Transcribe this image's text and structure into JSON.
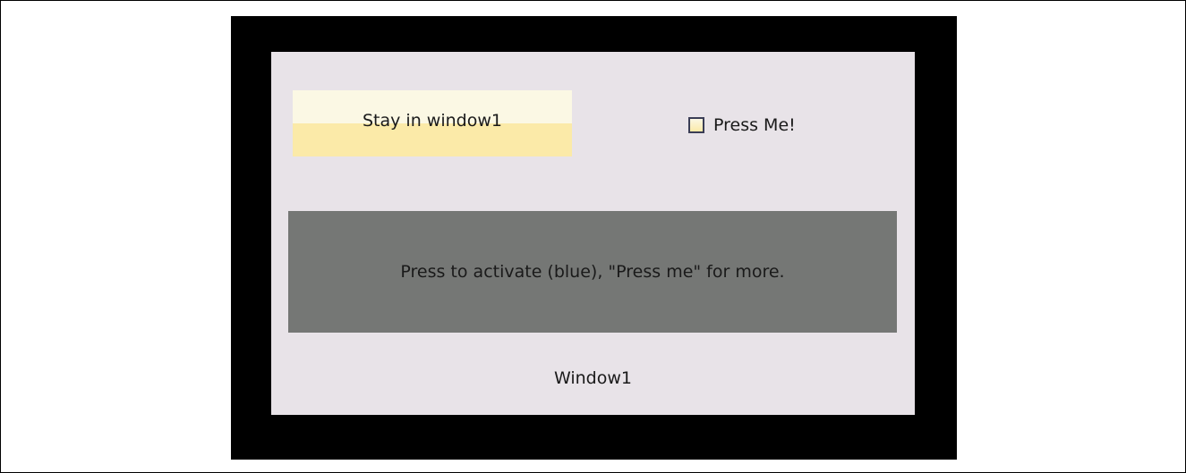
{
  "window": {
    "title": "Window1",
    "stay_button_label": "Stay in window1",
    "checkbox": {
      "label": "Press Me!",
      "checked": false
    },
    "activate_area_text": "Press to activate (blue), \"Press me\" for more."
  },
  "colors": {
    "screen_bg": "#000000",
    "window_bg": "#e8e3e8",
    "button_top": "#fbf8e4",
    "button_bottom": "#fbeaa8",
    "activate_bg": "#757775"
  }
}
